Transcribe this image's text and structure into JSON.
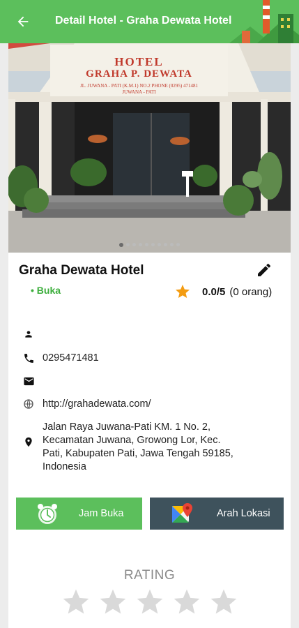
{
  "appbar": {
    "title": "Detail Hotel - Graha Dewata Hotel"
  },
  "photo": {
    "sign_line1": "HOTEL",
    "sign_line2": "GRAHA P. DEWATA",
    "sign_line3": "JL. JUWANA - PATI (K.M.1) NO.2 PHONE (0295) 471481",
    "sign_line4": "JUWANA - PATI",
    "slide_count": 10,
    "active_slide": 1
  },
  "hotel": {
    "name": "Graha Dewata Hotel",
    "status": "• Buka",
    "score": "0.0/5",
    "votes": "(0 orang)"
  },
  "info": {
    "contact_person": "",
    "phone": "0295471481",
    "email": "",
    "website": "http://grahadewata.com/",
    "address_lines": [
      "Jalan Raya Juwana-Pati KM. 1 No. 2,",
      "Kecamatan Juwana, Growong Lor, Kec.",
      "Pati, Kabupaten Pati, Jawa Tengah 59185,",
      "Indonesia"
    ]
  },
  "actions": {
    "hours_label": "Jam Buka",
    "directions_label": "Arah Lokasi"
  },
  "rating_section": {
    "title": "RATING",
    "stars_total": 5,
    "stars_selected": 0
  },
  "colors": {
    "primary_green": "#5cbf5c",
    "dark_button": "#3e525c",
    "star_active": "#f39c12",
    "star_inactive": "#d9d9d9",
    "status_green": "#3cae3c"
  }
}
